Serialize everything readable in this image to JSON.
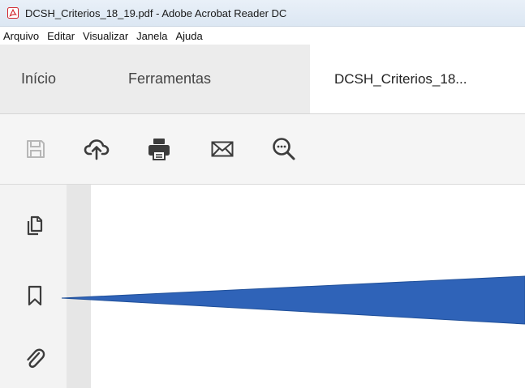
{
  "window": {
    "title": "DCSH_Criterios_18_19.pdf - Adobe Acrobat Reader DC",
    "app_icon": "pdf-icon"
  },
  "menu": {
    "items": [
      "Arquivo",
      "Editar",
      "Visualizar",
      "Janela",
      "Ajuda"
    ]
  },
  "tabs": {
    "home": "Início",
    "tools": "Ferramentas",
    "document": "DCSH_Criterios_18..."
  },
  "toolbar": {
    "icons": [
      "save-icon",
      "cloud-upload-icon",
      "print-icon",
      "email-icon",
      "zoom-icon"
    ]
  },
  "leftnav": {
    "icons": [
      "page-thumbnails-icon",
      "bookmark-icon",
      "attachments-icon"
    ]
  },
  "colors": {
    "titlebar": "#dce7f3",
    "callout": "#2f63b8",
    "pdf_red": "#d2232a"
  }
}
